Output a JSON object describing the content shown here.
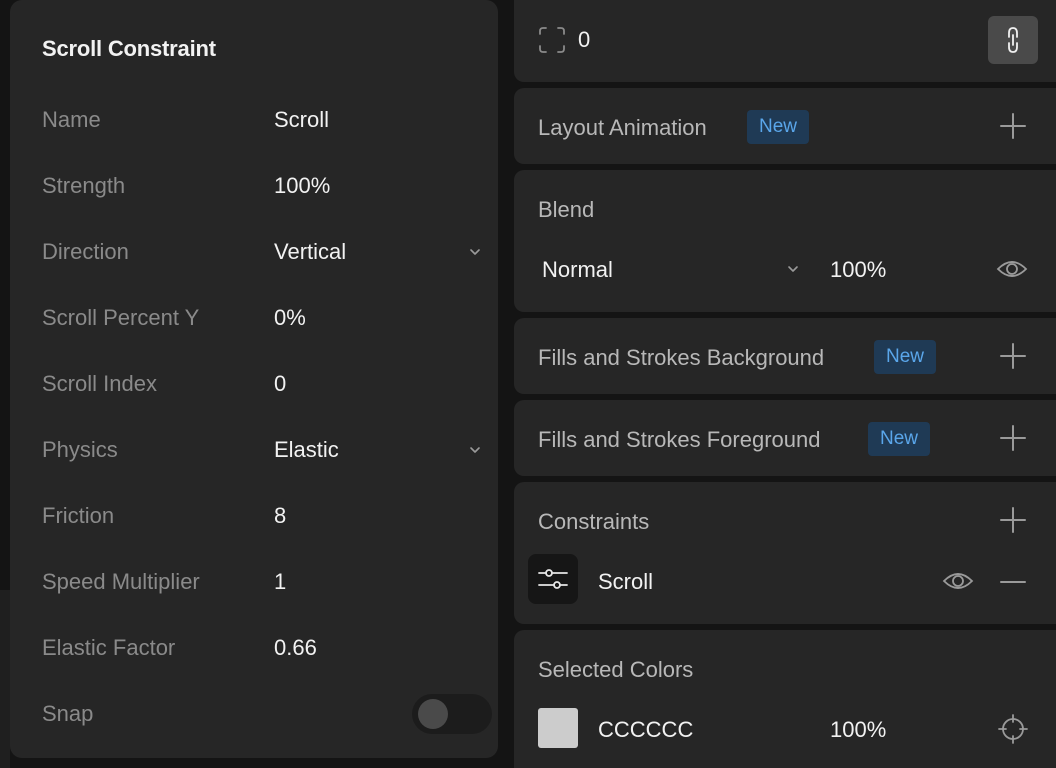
{
  "popover": {
    "title": "Scroll Constraint",
    "rows": [
      {
        "label": "Name",
        "value": "Scroll"
      },
      {
        "label": "Strength",
        "value": "100%"
      },
      {
        "label": "Direction",
        "value": "Vertical"
      },
      {
        "label": "Scroll Percent Y",
        "value": "0%"
      },
      {
        "label": "Scroll Index",
        "value": "0"
      },
      {
        "label": "Physics",
        "value": "Elastic"
      },
      {
        "label": "Friction",
        "value": "8"
      },
      {
        "label": "Speed Multiplier",
        "value": "1"
      },
      {
        "label": "Elastic Factor",
        "value": "0.66"
      },
      {
        "label": "Snap",
        "value": ""
      }
    ],
    "snap_enabled": false
  },
  "panel": {
    "radius": {
      "value": "0",
      "icon": "corner-radius-icon",
      "link_icon": "link-icon"
    },
    "layout_animation": {
      "title": "Layout Animation",
      "badge": "New"
    },
    "blend": {
      "title": "Blend",
      "mode": "Normal",
      "opacity": "100%"
    },
    "fills_background": {
      "title": "Fills and Strokes Background",
      "badge": "New"
    },
    "fills_foreground": {
      "title": "Fills and Strokes Foreground",
      "badge": "New"
    },
    "constraints": {
      "title": "Constraints",
      "item_label": "Scroll"
    },
    "selected_colors": {
      "title": "Selected Colors",
      "hex": "CCCCCC",
      "opacity": "100%",
      "swatch": "#cccccc"
    }
  },
  "colors": {
    "accent_badge_bg": "#1f3a55",
    "accent_badge_text": "#5aa6ea"
  }
}
